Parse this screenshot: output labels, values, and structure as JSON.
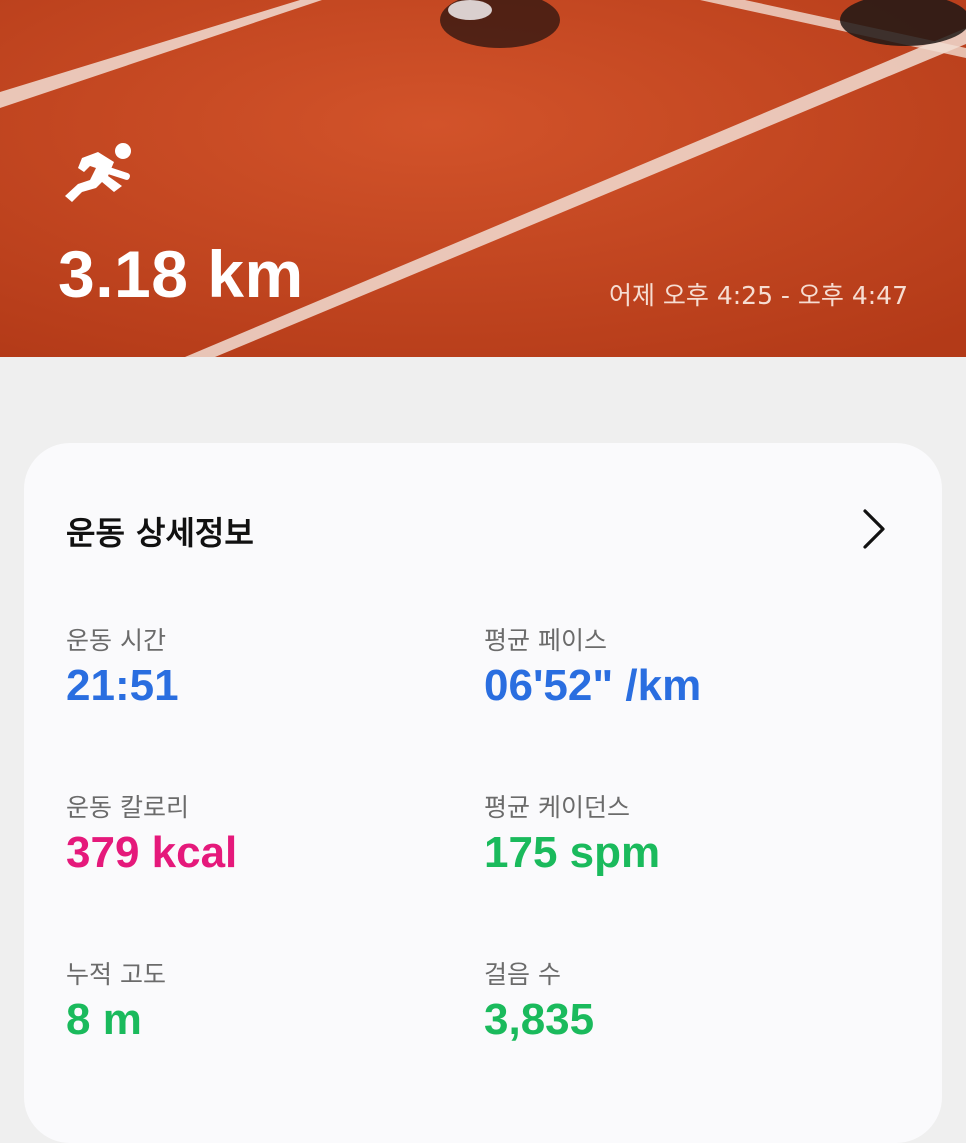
{
  "header": {
    "activity_icon": "running-icon",
    "distance": "3.18 km",
    "time_range": "어제 오후 4:25 - 오후 4:47"
  },
  "details": {
    "title": "운동 상세정보",
    "more_icon": "chevron-right-icon",
    "stats": {
      "duration": {
        "label": "운동 시간",
        "value": "21:51"
      },
      "pace": {
        "label": "평균 페이스",
        "value": "06'52\" /km"
      },
      "calories": {
        "label": "운동 칼로리",
        "value": "379 kcal"
      },
      "cadence": {
        "label": "평균 케이던스",
        "value": "175 spm"
      },
      "elevation": {
        "label": "누적 고도",
        "value": "8 m"
      },
      "steps": {
        "label": "걸음 수",
        "value": "3,835"
      }
    }
  },
  "colors": {
    "track": "#c9471e",
    "blue": "#2a6ee0",
    "pink": "#e5197b",
    "green": "#1aba5c"
  }
}
